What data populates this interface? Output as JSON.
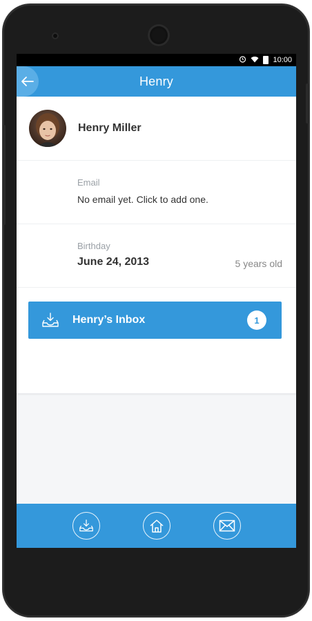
{
  "status_bar": {
    "time": "10:00",
    "icons": [
      "alarm-icon",
      "wifi-icon",
      "battery-icon"
    ]
  },
  "app_bar": {
    "title": "Henry",
    "back_icon": "back-arrow-icon"
  },
  "profile": {
    "name": "Henry Miller"
  },
  "email": {
    "label": "Email",
    "value": "No email yet. Click to add one."
  },
  "birthday": {
    "label": "Birthday",
    "value": "June 24, 2013",
    "age": "5 years old"
  },
  "inbox": {
    "label": "Henry’s Inbox",
    "count": "1",
    "icon": "inbox-download-icon"
  },
  "bottom_nav": {
    "items": [
      "inbox-icon",
      "home-icon",
      "mail-icon"
    ]
  },
  "colors": {
    "primary": "#3498db",
    "background": "#f5f6f8",
    "text": "#333333",
    "muted": "#9aa0a6"
  }
}
